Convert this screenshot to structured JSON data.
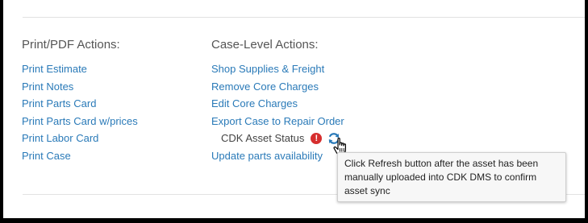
{
  "print_actions": {
    "heading": "Print/PDF Actions:",
    "links": [
      "Print Estimate",
      "Print Notes",
      "Print Parts Card",
      "Print Parts Card w/prices",
      "Print Labor Card",
      "Print Case"
    ]
  },
  "case_actions": {
    "heading": "Case-Level Actions:",
    "links": [
      "Shop Supplies & Freight",
      "Remove Core Charges",
      "Edit Core Charges",
      "Export Case to Repair Order"
    ],
    "asset_status": {
      "label": "CDK Asset Status",
      "error_icon": "exclamation-circle-icon",
      "refresh_icon": "refresh-icon",
      "error_glyph": "!"
    },
    "update_link": "Update parts availability"
  },
  "tooltip": {
    "text": "Click Refresh button after the asset has been manually uploaded into CDK DMS to confirm asset sync"
  },
  "colors": {
    "link": "#2a7ab8",
    "error": "#d62e2e",
    "refresh": "#2a7ab8"
  }
}
